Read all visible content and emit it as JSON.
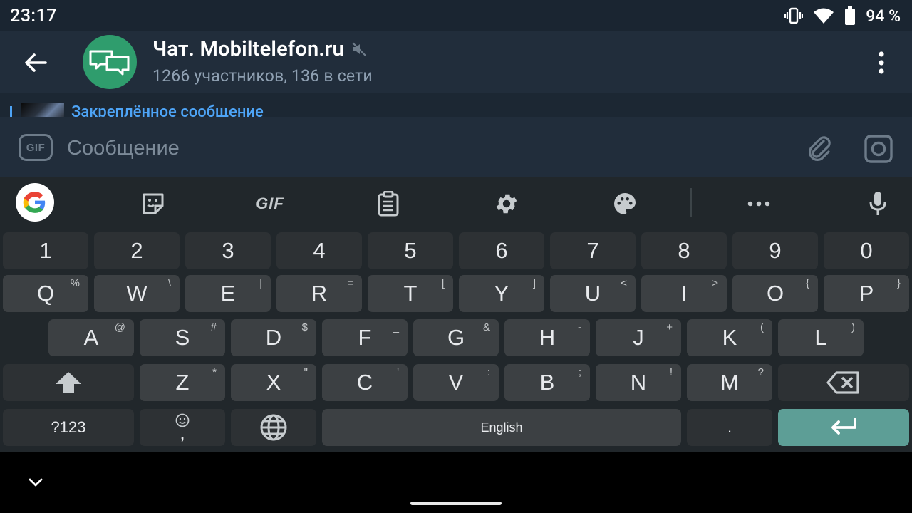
{
  "status": {
    "time": "23:17",
    "battery": "94 %"
  },
  "header": {
    "title": "Чат. Mobiltelefon.ru",
    "subtitle": "1266 участников, 136 в сети"
  },
  "pinned": {
    "label": "Закреплённое сообщение"
  },
  "composer": {
    "placeholder": "Сообщение",
    "gif_label": "GIF"
  },
  "keyboard": {
    "toolbar": {
      "gif_label": "GIF"
    },
    "rows": {
      "numbers": [
        "1",
        "2",
        "3",
        "4",
        "5",
        "6",
        "7",
        "8",
        "9",
        "0"
      ],
      "qwerty": [
        {
          "label": "Q",
          "hint": "%"
        },
        {
          "label": "W",
          "hint": "\\"
        },
        {
          "label": "E",
          "hint": "|"
        },
        {
          "label": "R",
          "hint": "="
        },
        {
          "label": "T",
          "hint": "["
        },
        {
          "label": "Y",
          "hint": "]"
        },
        {
          "label": "U",
          "hint": "<"
        },
        {
          "label": "I",
          "hint": ">"
        },
        {
          "label": "O",
          "hint": "{"
        },
        {
          "label": "P",
          "hint": "}"
        }
      ],
      "asdf": [
        {
          "label": "A",
          "hint": "@"
        },
        {
          "label": "S",
          "hint": "#"
        },
        {
          "label": "D",
          "hint": "$"
        },
        {
          "label": "F",
          "hint": "_"
        },
        {
          "label": "G",
          "hint": "&"
        },
        {
          "label": "H",
          "hint": "-"
        },
        {
          "label": "J",
          "hint": "+"
        },
        {
          "label": "K",
          "hint": "("
        },
        {
          "label": "L",
          "hint": ")"
        }
      ],
      "zxcv": [
        {
          "label": "Z",
          "hint": "*"
        },
        {
          "label": "X",
          "hint": "\""
        },
        {
          "label": "C",
          "hint": "'"
        },
        {
          "label": "V",
          "hint": ":"
        },
        {
          "label": "B",
          "hint": ";"
        },
        {
          "label": "N",
          "hint": "!"
        },
        {
          "label": "M",
          "hint": "?"
        }
      ]
    },
    "symbols_label": "?123",
    "comma_label": ",",
    "space_label": "English",
    "period_label": "."
  }
}
